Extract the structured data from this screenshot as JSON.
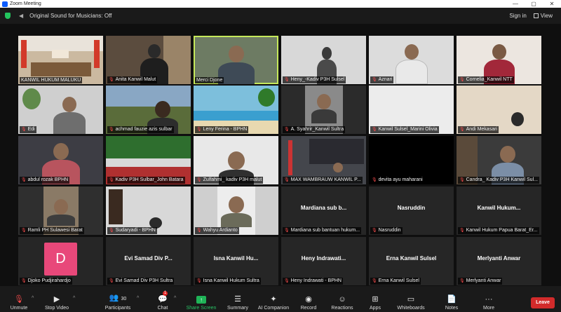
{
  "titlebar": {
    "title": "Zoom Meeting",
    "minimize": "—",
    "maximize": "▢",
    "close": "✕"
  },
  "topbar": {
    "sound_label": "Original Sound for Musicians: Off",
    "signin_label": "Sign in",
    "view_label": "View"
  },
  "tiles": [
    {
      "label": "KANWIL HUKUM MALUKU",
      "muted": false
    },
    {
      "label": "Anita Kanwil Malut",
      "muted": true
    },
    {
      "label": "Merci Djone",
      "muted": false
    },
    {
      "label": "Heny_-Kadiv P3H Sulsel",
      "muted": true
    },
    {
      "label": "Aznari",
      "muted": true
    },
    {
      "label": "Cornelia_Kanwil NTT",
      "muted": true
    },
    {
      "label": "Edi",
      "muted": true
    },
    {
      "label": "achmad fauzie azis sulbar",
      "muted": true
    },
    {
      "label": "Leny Ferina - BPHN",
      "muted": true
    },
    {
      "label": "A. Syahrir_Kanwil Sultra",
      "muted": true
    },
    {
      "label": "Kanwil Sulsel_Marini Olivia",
      "muted": true
    },
    {
      "label": "Andi Mekasari",
      "muted": true
    },
    {
      "label": "abdul rozak BPHN",
      "muted": true
    },
    {
      "label": "Kadiv P3H Sulbar_John Batara",
      "muted": true
    },
    {
      "label": "Zulfahmi_ kadiv P3H malut",
      "muted": true
    },
    {
      "label": "MAX WAMBRAUW KANWIL P...",
      "muted": true
    },
    {
      "label": "devita ayu maharani",
      "muted": true
    },
    {
      "label": "Candra_ Kadiv P3H Kanwil Sul...",
      "muted": true
    },
    {
      "label": "Ramli PH Sulawesi Barat",
      "muted": true
    },
    {
      "label": "Sudaryadi - BPHN",
      "muted": true
    },
    {
      "label": "Wahyu Ardianto",
      "muted": true
    },
    {
      "label": "Mardiana sub bantuan hukum...",
      "muted": true,
      "center": "Mardiana sub b..."
    },
    {
      "label": "Nasruddin",
      "muted": true,
      "center": "Nasruddin"
    },
    {
      "label": "Kanwil Hukum Papua Barat_Er...",
      "muted": true,
      "center": "Kanwil Hukum..."
    },
    {
      "label": "Djoko Pudjirahardjo",
      "muted": true,
      "avatar": "D"
    },
    {
      "label": "Evi Samad Div P3H Sultra",
      "muted": true,
      "center": "Evi Samad Div P..."
    },
    {
      "label": "Isna Kanwil Hukum Sultra",
      "muted": true,
      "center": "Isna Kanwil Hu..."
    },
    {
      "label": "Heny Indrawati - BPHN",
      "muted": true,
      "center": "Heny Indrawati..."
    },
    {
      "label": "Erna Kanwil Sulsel",
      "muted": true,
      "center": "Erna Kanwil Sulsel"
    },
    {
      "label": "Merlyanti Anwar",
      "muted": true,
      "center": "Merlyanti Anwar"
    }
  ],
  "toolbar": {
    "unmute": "Unmute",
    "stop_video": "Stop Video",
    "participants": "Participants",
    "participants_count": "30",
    "chat": "Chat",
    "chat_badge": "1",
    "share": "Share Screen",
    "summary": "Summary",
    "ai": "AI Companion",
    "record": "Record",
    "reactions": "Reactions",
    "apps": "Apps",
    "whiteboards": "Whiteboards",
    "notes": "Notes",
    "more": "More",
    "leave": "Leave"
  },
  "colors": {
    "accent_green": "#23c45e",
    "leave_red": "#d22b2b",
    "avatar_pink": "#e8487a",
    "active_outline": "#c5e85a"
  }
}
